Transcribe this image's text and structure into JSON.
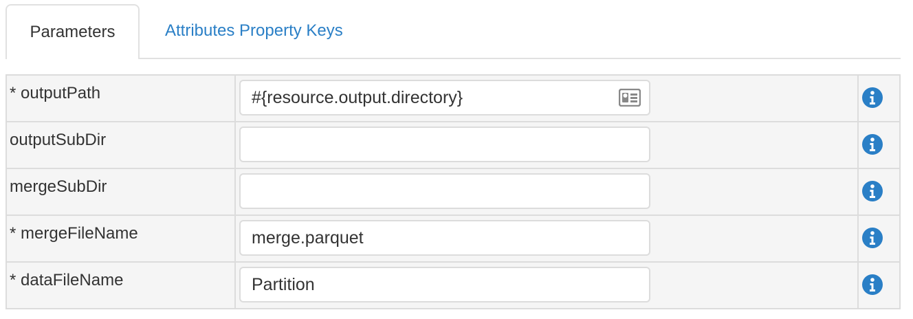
{
  "tabs": {
    "parameters": "Parameters",
    "attributes": "Attributes Property Keys"
  },
  "colors": {
    "link": "#2a7fc6",
    "info": "#2a7fc6",
    "row_background": "#f5f5f5",
    "border": "#dcdcdc"
  },
  "params": [
    {
      "label": "* outputPath",
      "value": "#{resource.output.directory}",
      "has_card_icon": true,
      "icon": "id-card-icon"
    },
    {
      "label": "outputSubDir",
      "value": ""
    },
    {
      "label": "mergeSubDir",
      "value": ""
    },
    {
      "label": "* mergeFileName",
      "value": "merge.parquet"
    },
    {
      "label": "* dataFileName",
      "value": "Partition"
    }
  ]
}
